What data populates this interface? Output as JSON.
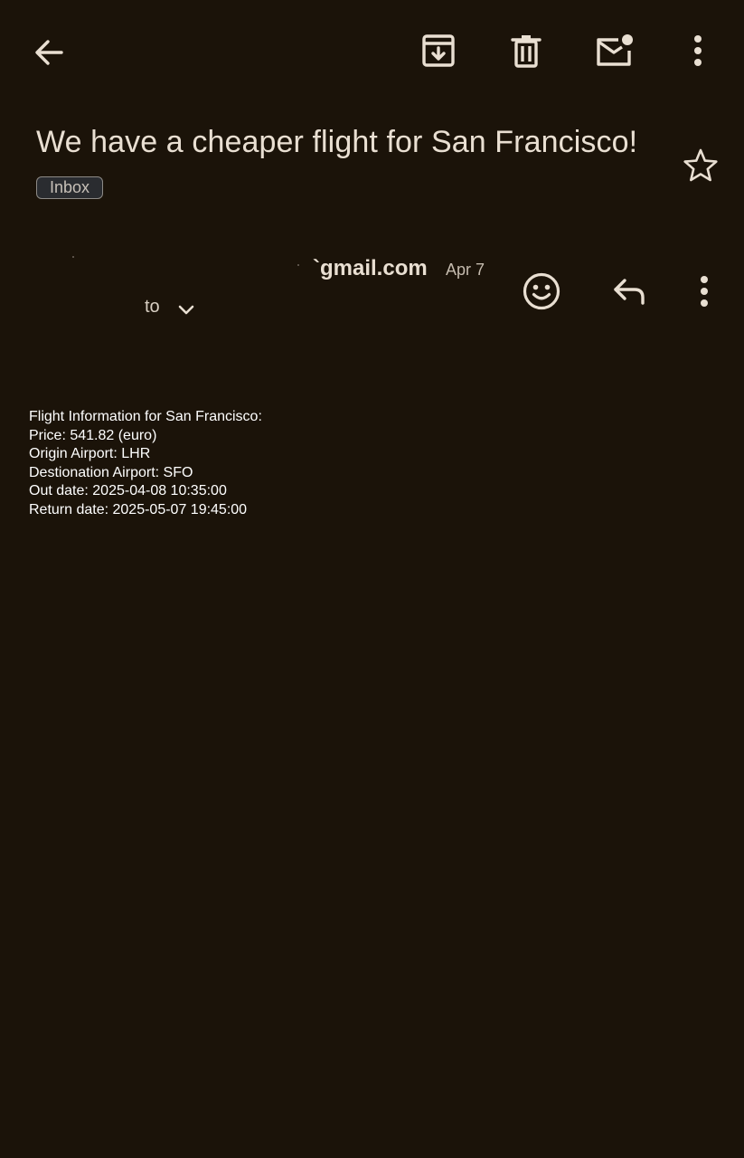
{
  "toolbar": {
    "back_icon": "arrow-left-icon",
    "archive_icon": "archive-icon",
    "delete_icon": "trash-icon",
    "mark_unread_icon": "mail-unread-icon",
    "more_icon": "more-vert-icon"
  },
  "email": {
    "subject": "We have a cheaper flight for San Francisco!",
    "label": "Inbox",
    "starred": false,
    "sender_email_visible": "`gmail.com",
    "date": "Apr 7",
    "recipient_label": "to",
    "body_lines": [
      "Flight Information for San Francisco:",
      "Price: 541.82 (euro)",
      "Origin Airport: LHR",
      "Destionation Airport: SFO",
      "Out date: 2025-04-08 10:35:00",
      "Return date: 2025-05-07 19:45:00"
    ]
  },
  "colors": {
    "background": "#1b1309",
    "icon": "#e9dfd2",
    "text": "#e9dfd2",
    "body_text": "#ffffff"
  }
}
